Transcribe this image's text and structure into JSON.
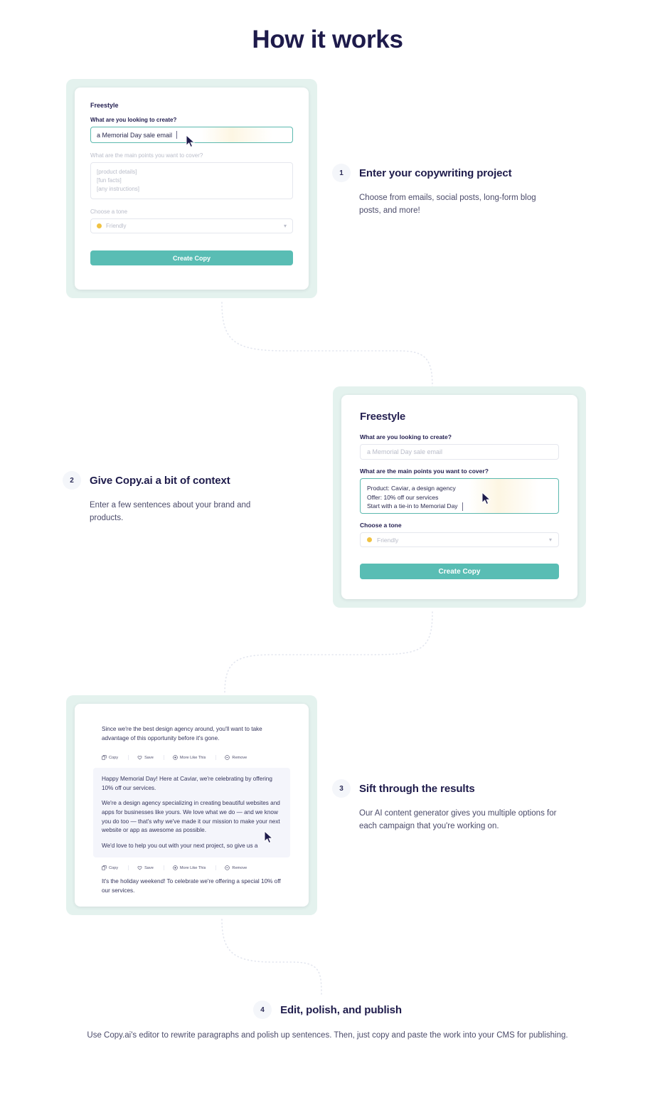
{
  "page": {
    "title": "How it works"
  },
  "colors": {
    "heading": "#1e1b4b",
    "accent_teal": "#59bdb4",
    "card_frame": "#e4f2ee",
    "tone_dot": "#f0c243",
    "body_text": "#4b4b6a"
  },
  "card1": {
    "app_title": "Freestyle",
    "label_create": "What are you looking to create?",
    "input_create_value": "a Memorial Day sale email",
    "label_points": "What are the main points you want to cover?",
    "points_placeholder_lines": [
      "[product details]",
      "[fun facts]",
      "[any instructions]"
    ],
    "label_tone": "Choose a tone",
    "tone_value": "Friendly",
    "cta_label": "Create Copy"
  },
  "card2": {
    "app_title": "Freestyle",
    "label_create": "What are you looking to create?",
    "input_create_placeholder": "a Memorial Day sale email",
    "label_points": "What are the main points you want to cover?",
    "points_value_lines": [
      "Product: Caviar, a design agency",
      "Offer: 10% off our services",
      "Start with a tie-in to Memorial Day"
    ],
    "label_tone": "Choose a tone",
    "tone_value": "Friendly",
    "cta_label": "Create Copy"
  },
  "card3": {
    "result_top": "Since we're the best design agency around, you'll want to take advantage of this opportunity before it's gone.",
    "result_middle_p1": "Happy Memorial Day! Here at Caviar, we're celebrating by offering 10% off our services.",
    "result_middle_p2": "We're a design agency specializing in creating beautiful websites and apps for businesses like yours. We love what we do — and we know you do too — that's why we've made it our mission to make your next website or app as awesome as possible.",
    "result_middle_p3": "We'd love to help you out with your next project, so give us a",
    "result_bottom": "It's the holiday weekend! To celebrate we're offering a special 10% off our services.",
    "actions": [
      {
        "label": "Copy",
        "icon": "copy-icon"
      },
      {
        "label": "Save",
        "icon": "heart-icon"
      },
      {
        "label": "More Like This",
        "icon": "plus-circle-icon"
      },
      {
        "label": "Remove",
        "icon": "minus-circle-icon"
      }
    ]
  },
  "steps": [
    {
      "number": "1",
      "title": "Enter your copywriting project",
      "body": "Choose from emails, social posts, long-form blog posts, and more!"
    },
    {
      "number": "2",
      "title": "Give Copy.ai a bit of context",
      "body": "Enter a few sentences about your brand and products."
    },
    {
      "number": "3",
      "title": "Sift through the results",
      "body": "Our AI content generator gives you multiple options for each campaign that you're working on."
    },
    {
      "number": "4",
      "title": "Edit, polish, and publish",
      "body": "Use Copy.ai's editor to rewrite paragraphs and polish up sentences. Then, just copy and paste the work into your CMS for publishing."
    }
  ]
}
